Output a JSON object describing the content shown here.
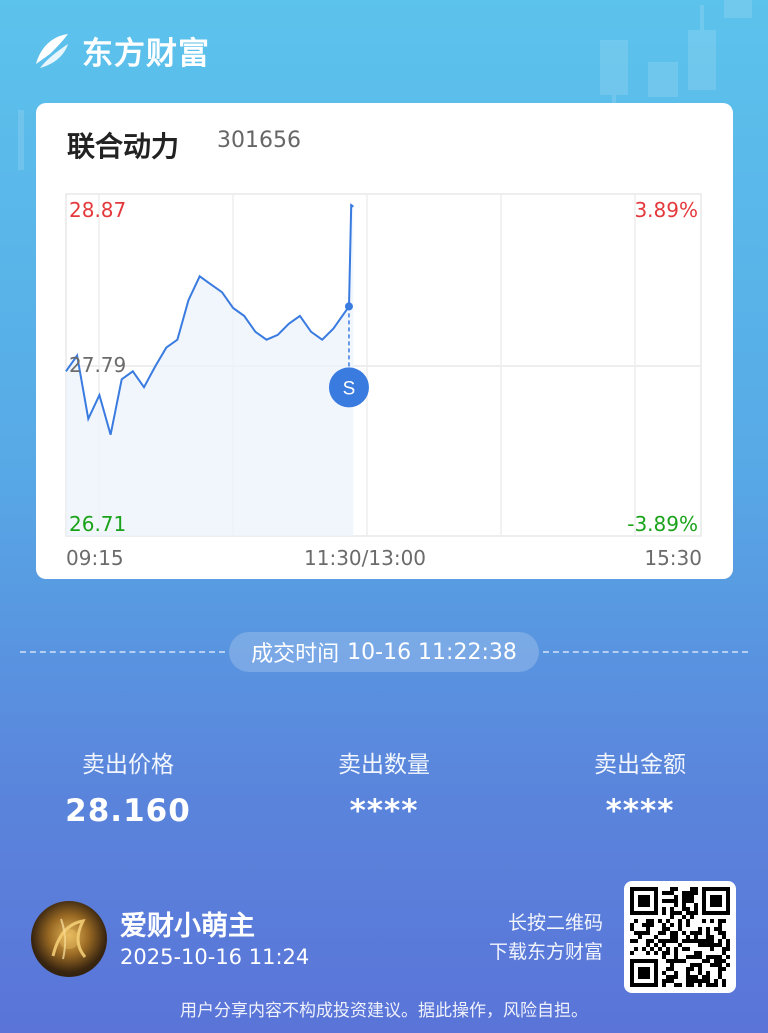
{
  "brand": {
    "name": "东方财富"
  },
  "stock": {
    "name": "联合动力",
    "code": "301656"
  },
  "chart": {
    "y_high": "28.87",
    "y_mid": "27.79",
    "y_low": "26.71",
    "pct_high": "3.89%",
    "pct_low": "-3.89%",
    "x_start": "09:15",
    "x_mid": "11:30/13:00",
    "x_end": "15:30",
    "marker": "S",
    "colors": {
      "line": "#3a7be0",
      "up": "#e4393c",
      "down": "#1aa31a"
    }
  },
  "chart_data": {
    "type": "line",
    "title": "",
    "xlabel": "",
    "ylabel": "",
    "x": [
      "09:15",
      "09:20",
      "09:25",
      "09:30",
      "09:35",
      "09:40",
      "09:45",
      "09:50",
      "09:55",
      "10:00",
      "10:05",
      "10:10",
      "10:15",
      "10:20",
      "10:25",
      "10:30",
      "10:35",
      "10:40",
      "10:45",
      "10:50",
      "10:55",
      "11:00",
      "11:05",
      "11:10",
      "11:15",
      "11:20",
      "11:22",
      "11:23",
      "11:24"
    ],
    "y": [
      27.75,
      27.85,
      27.45,
      27.6,
      27.35,
      27.7,
      27.75,
      27.65,
      27.78,
      27.9,
      27.95,
      28.2,
      28.35,
      28.3,
      28.25,
      28.15,
      28.1,
      28.0,
      27.95,
      27.98,
      28.05,
      28.1,
      28.0,
      27.95,
      28.02,
      28.12,
      28.16,
      28.8,
      28.79
    ],
    "ylim": [
      26.71,
      28.87
    ],
    "xlim": [
      "09:15",
      "15:30"
    ],
    "reference": 27.79,
    "grid": true,
    "trade_marker": {
      "label": "S",
      "time": "11:22",
      "price": 28.16
    }
  },
  "trade": {
    "time_label": "成交时间",
    "time_value": "10-16 11:22:38",
    "price_label": "卖出价格",
    "price_value": "28.160",
    "qty_label": "卖出数量",
    "qty_value": "****",
    "amount_label": "卖出金额",
    "amount_value": "****"
  },
  "user": {
    "name": "爱财小萌主",
    "time": "2025-10-16 11:24"
  },
  "download": {
    "line1": "长按二维码",
    "line2": "下载东方财富"
  },
  "disclaimer": "用户分享内容不构成投资建议。据此操作，风险自担。"
}
